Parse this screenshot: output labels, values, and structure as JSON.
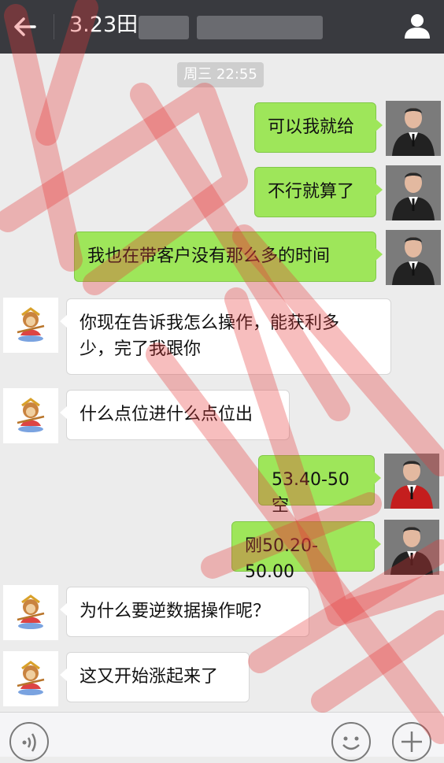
{
  "header": {
    "title": "3.23田"
  },
  "timestamp": "周三 22:55",
  "messages": [
    {
      "side": "me",
      "text": "可以我就给"
    },
    {
      "side": "me",
      "text": "不行就算了"
    },
    {
      "side": "me",
      "text": "我也在带客户没有那么多的时间"
    },
    {
      "side": "them",
      "line1": "你现在告诉我怎么操作，能获利多",
      "line2": "少，完了我跟你"
    },
    {
      "side": "them",
      "text": "什么点位进什么点位出"
    },
    {
      "side": "me",
      "text": "53.40-50空"
    },
    {
      "side": "me",
      "text": "刚50.20-50.00"
    },
    {
      "side": "them",
      "text": "为什么要逆数据操作呢？"
    },
    {
      "side": "them",
      "text": "这又开始涨起来了"
    }
  ],
  "icons": {
    "back": "arrow-left-icon",
    "profile": "person-icon",
    "voice": "voice-icon",
    "emoji": "emoji-icon",
    "plus": "plus-icon"
  },
  "colors": {
    "topbar": "#393a3f",
    "background": "#ececec",
    "my_bubble": "#9ee65a",
    "their_bubble": "#ffffff",
    "watermark": "#e83a3a"
  }
}
